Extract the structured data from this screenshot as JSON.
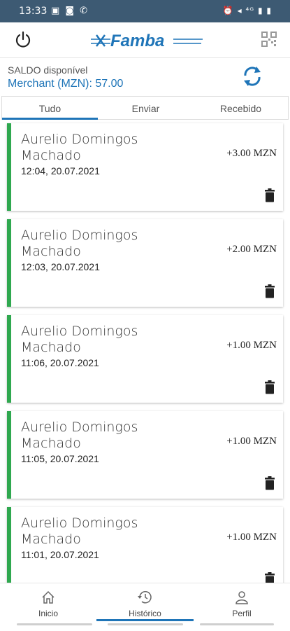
{
  "status_bar": {
    "time": "13:33"
  },
  "app": {
    "logo_text": "Famba"
  },
  "balance": {
    "label": "SALDO disponível",
    "value": "Merchant (MZN): 57.00"
  },
  "tabs": [
    {
      "label": "Tudo",
      "active": true
    },
    {
      "label": "Enviar",
      "active": false
    },
    {
      "label": "Recebido",
      "active": false
    }
  ],
  "transactions": [
    {
      "name": "Aurelio Domingos Machado",
      "datetime": "12:04, 20.07.2021",
      "amount": "+3.00 MZN"
    },
    {
      "name": "Aurelio Domingos Machado",
      "datetime": "12:03, 20.07.2021",
      "amount": "+2.00 MZN"
    },
    {
      "name": "Aurelio Domingos Machado",
      "datetime": "11:06, 20.07.2021",
      "amount": "+1.00 MZN"
    },
    {
      "name": "Aurelio Domingos Machado",
      "datetime": "11:05, 20.07.2021",
      "amount": "+1.00 MZN"
    },
    {
      "name": "Aurelio Domingos Machado",
      "datetime": "11:01, 20.07.2021",
      "amount": "+1.00 MZN"
    }
  ],
  "bottom_nav": [
    {
      "label": "Inicio",
      "icon": "home-icon",
      "active": false
    },
    {
      "label": "Histórico",
      "icon": "history-icon",
      "active": true
    },
    {
      "label": "Perfil",
      "icon": "profile-icon",
      "active": false
    }
  ],
  "colors": {
    "accent": "#1f75b8",
    "status_bar": "#3d5a73",
    "positive": "#2fa84f"
  }
}
